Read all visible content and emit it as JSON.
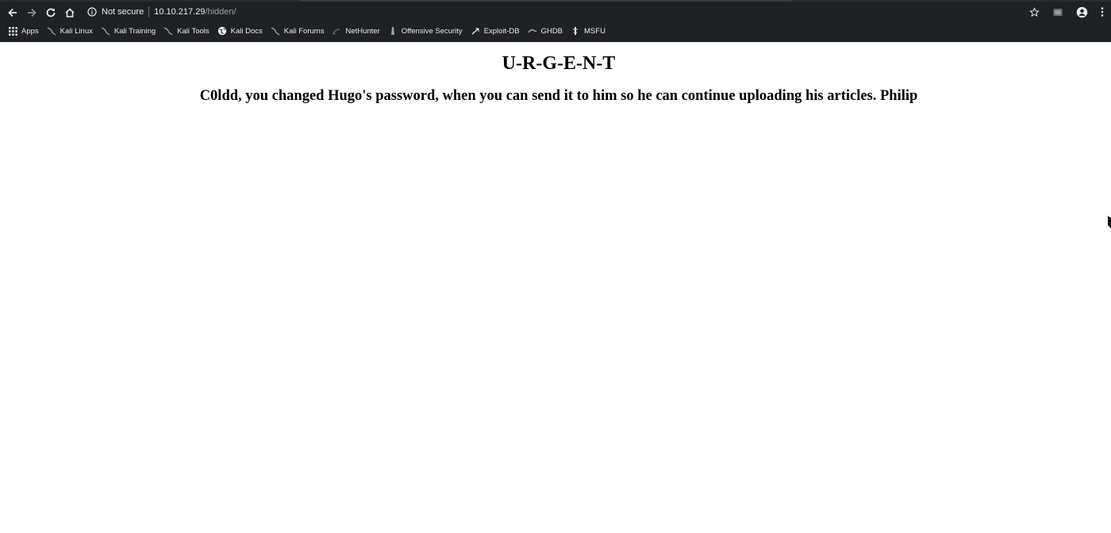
{
  "browser": {
    "security_label": "Not secure",
    "url_host": "10.10.217.29",
    "url_path": "/hidden/",
    "bookmarks": [
      {
        "label": "Apps",
        "icon": "apps-grid-icon"
      },
      {
        "label": "Kali Linux",
        "icon": "kali-dragon-icon"
      },
      {
        "label": "Kali Training",
        "icon": "kali-dragon-icon"
      },
      {
        "label": "Kali Tools",
        "icon": "kali-dragon-icon"
      },
      {
        "label": "Kali Docs",
        "icon": "globe-icon"
      },
      {
        "label": "Kali Forums",
        "icon": "kali-dragon-icon"
      },
      {
        "label": "NetHunter",
        "icon": "nethunter-icon"
      },
      {
        "label": "Offensive Security",
        "icon": "offsec-icon"
      },
      {
        "label": "Exploit-DB",
        "icon": "exploitdb-icon"
      },
      {
        "label": "GHDB",
        "icon": "ghdb-icon"
      },
      {
        "label": "MSFU",
        "icon": "msfu-icon"
      }
    ],
    "colors": {
      "chrome_bg": "#202124",
      "text": "#e8eaed",
      "url_path": "#9aa0a6"
    }
  },
  "page": {
    "heading": "U-R-G-E-N-T",
    "message": "C0ldd, you changed Hugo's password, when you can send it to him so he can continue uploading his articles. Philip"
  }
}
